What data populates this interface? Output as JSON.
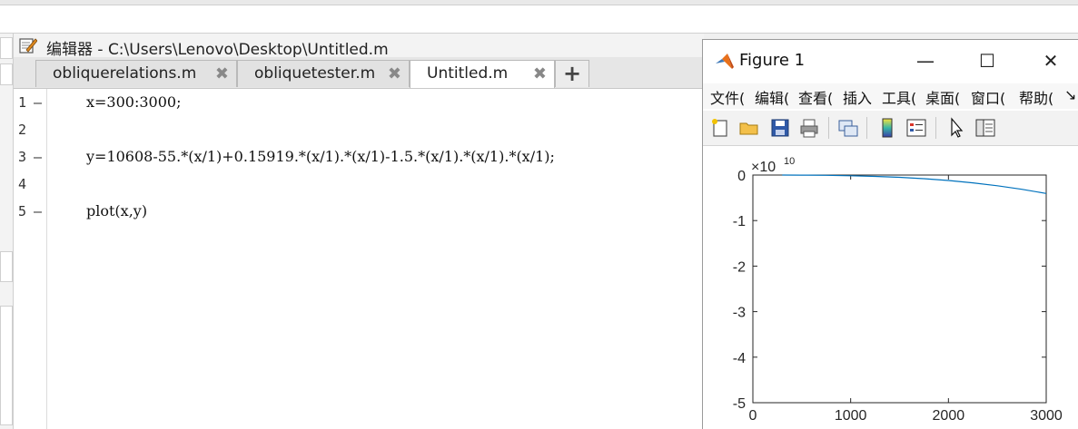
{
  "editor": {
    "title": "编辑器 - C:\\Users\\Lenovo\\Desktop\\Untitled.m",
    "tabs": [
      {
        "label": "obliquerelations.m",
        "active": false
      },
      {
        "label": "obliquetester.m",
        "active": false
      },
      {
        "label": "Untitled.m",
        "active": true
      }
    ],
    "close_glyph": "✖",
    "add_glyph": "+",
    "lines": [
      {
        "num": "1",
        "marker": "—",
        "code": "x=300:3000;"
      },
      {
        "num": "2",
        "marker": "",
        "code": ""
      },
      {
        "num": "3",
        "marker": "—",
        "code": "y=10608-55.*(x/1)+0.15919.*(x/1).*(x/1)-1.5.*(x/1).*(x/1).*(x/1);"
      },
      {
        "num": "4",
        "marker": "",
        "code": ""
      },
      {
        "num": "5",
        "marker": "—",
        "code": "plot(x,y)"
      }
    ]
  },
  "figure": {
    "title": "Figure 1",
    "window_buttons": {
      "minimize": "—",
      "maximize": "☐",
      "close": "✕"
    },
    "menu": [
      "文件(",
      "编辑(",
      "查看(",
      "插入",
      "工具(",
      "桌面(",
      "窗口(",
      "帮助("
    ],
    "menu_overflow": "↘",
    "toolbar_icons": [
      "new-figure-icon",
      "open-file-icon",
      "save-icon",
      "print-icon",
      "link-plot-icon",
      "colorbar-icon",
      "legend-icon",
      "pointer-icon",
      "property-editor-icon"
    ]
  },
  "chart_data": {
    "type": "line",
    "title": "",
    "xlabel": "",
    "ylabel": "",
    "xlim": [
      0,
      3000
    ],
    "ylim": [
      -5,
      0
    ],
    "y_exponent_label": "×10",
    "y_exponent_power": "10",
    "xticks": [
      0,
      1000,
      2000,
      3000
    ],
    "yticks": [
      0,
      -1,
      -2,
      -3,
      -4,
      -5
    ],
    "xtick_labels": [
      "0",
      "1000",
      "2000",
      "3000"
    ],
    "ytick_labels": [
      "0",
      "-1",
      "-2",
      "-3",
      "-4",
      "-5"
    ],
    "series": [
      {
        "color": "#0072BD",
        "x": [
          300,
          500,
          750,
          1000,
          1250,
          1500,
          1750,
          2000,
          2250,
          2500,
          2750,
          3000
        ],
        "y": [
          -0.0004,
          -0.0019,
          -0.0063,
          -0.015,
          -0.0293,
          -0.0506,
          -0.0804,
          -0.1199,
          -0.1708,
          -0.2343,
          -0.3119,
          -0.4049
        ]
      }
    ]
  }
}
